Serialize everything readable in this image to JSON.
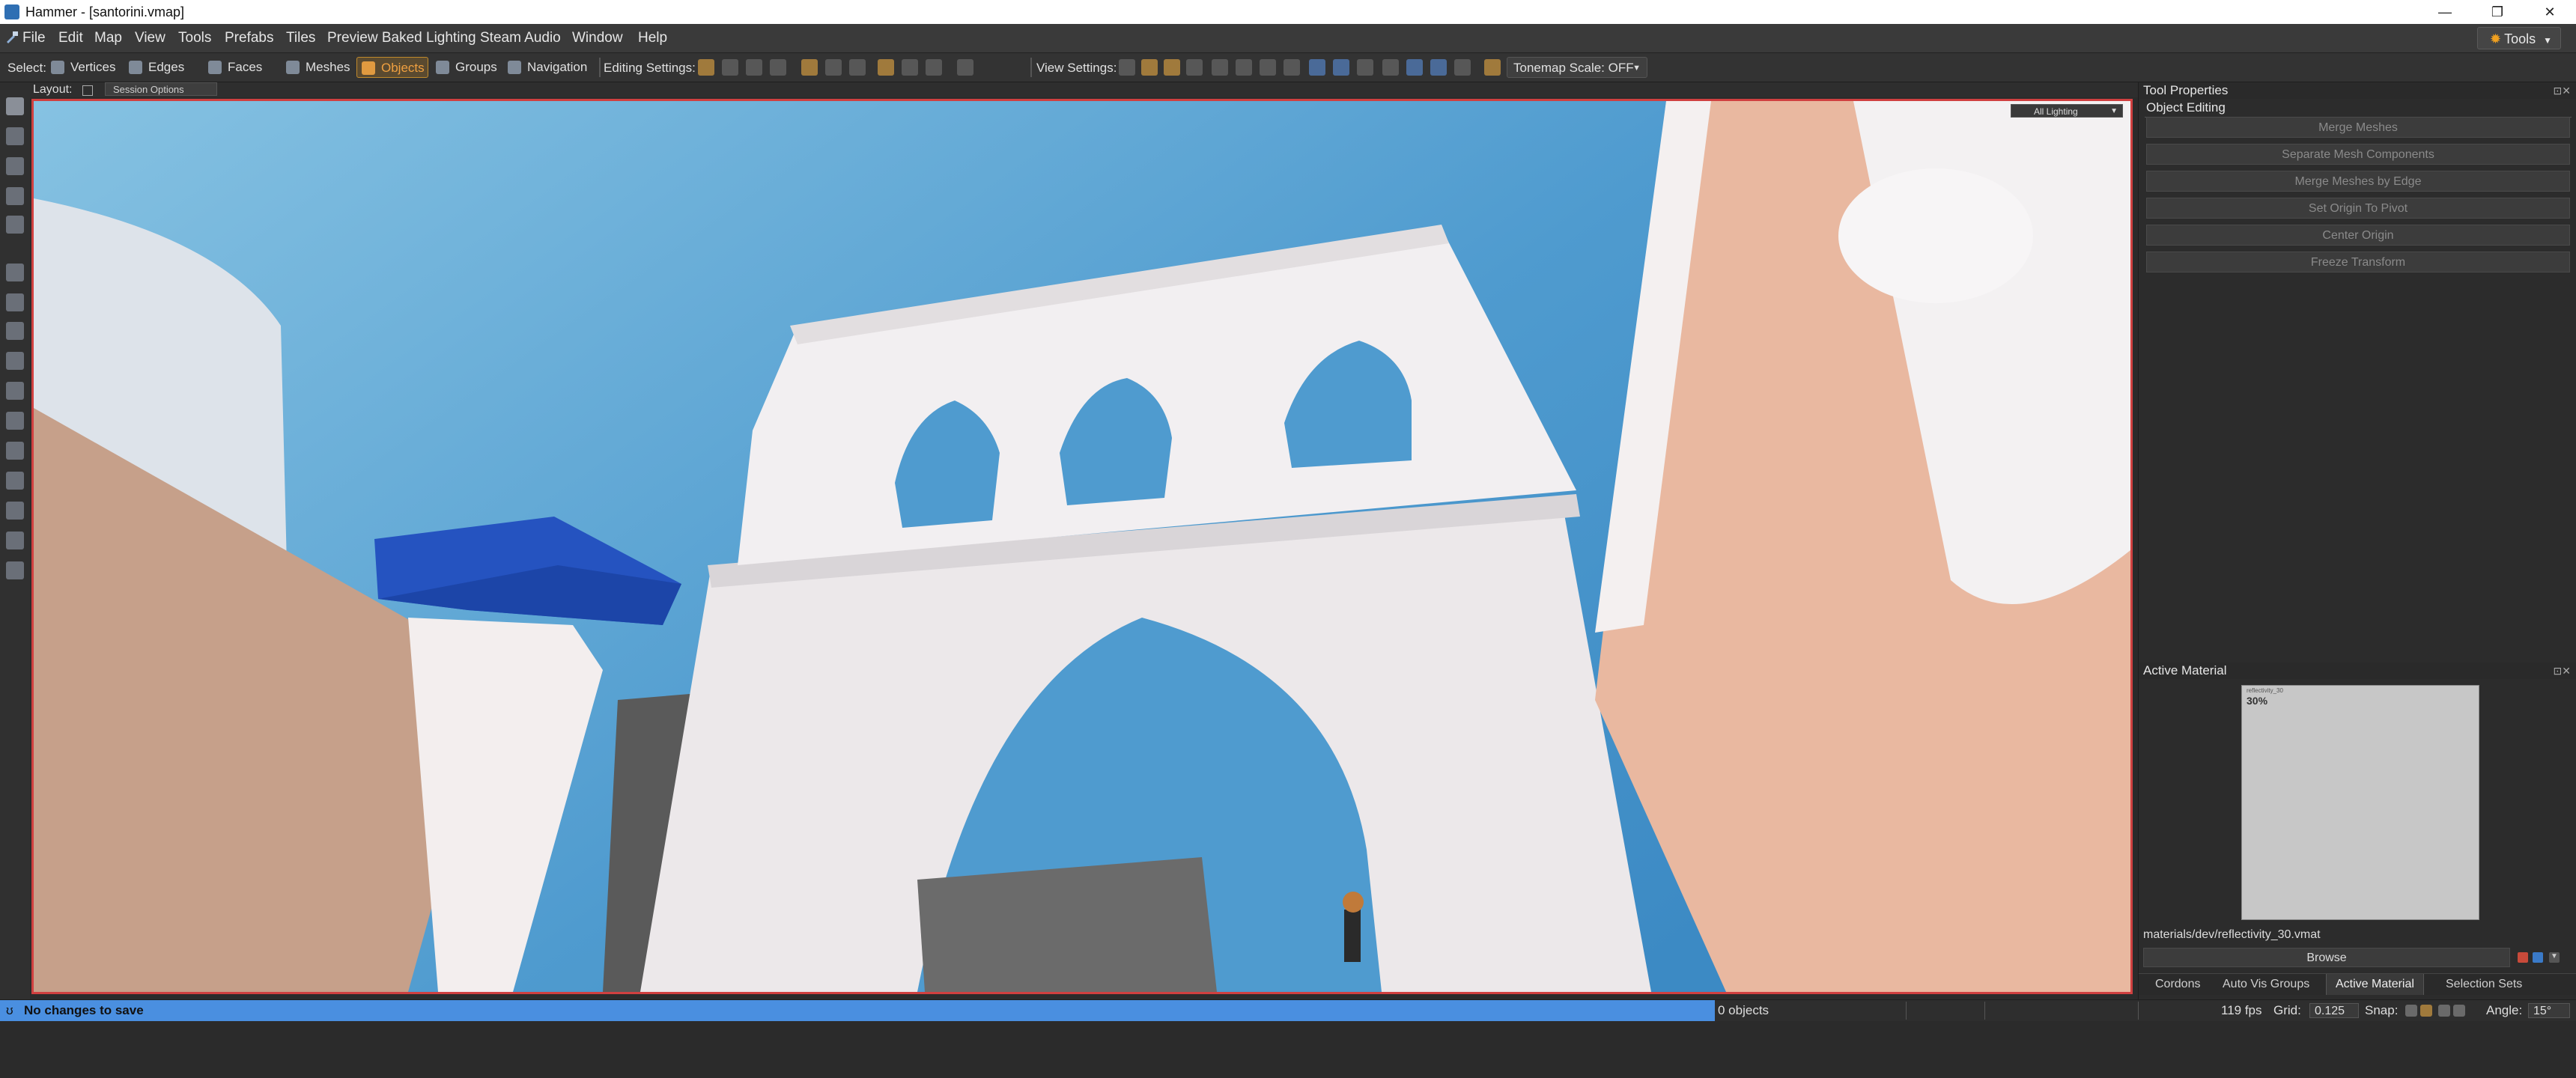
{
  "window": {
    "title": "Hammer - [santorini.vmap]",
    "minimize": "—",
    "restore": "❐",
    "close": "✕"
  },
  "menu": {
    "items": [
      "File",
      "Edit",
      "Map",
      "View",
      "Tools",
      "Prefabs",
      "Tiles",
      "Preview Baked Lighting",
      "Steam Audio",
      "Window",
      "Help"
    ],
    "tools_dropdown": "Tools"
  },
  "toolbar": {
    "select_label": "Select:",
    "select_modes": [
      {
        "label": "Vertices",
        "active": false
      },
      {
        "label": "Edges",
        "active": false
      },
      {
        "label": "Faces",
        "active": false
      },
      {
        "label": "Meshes",
        "active": false
      },
      {
        "label": "Objects",
        "active": true
      },
      {
        "label": "Groups",
        "active": false
      },
      {
        "label": "Navigation",
        "active": false
      }
    ],
    "editing_settings_label": "Editing Settings:",
    "view_settings_label": "View Settings:",
    "tonemap_label": "Tonemap Scale: OFF"
  },
  "layout": {
    "label": "Layout:",
    "dropdown": "Session Options"
  },
  "viewport": {
    "lighting_mode": "All Lighting"
  },
  "tool_properties": {
    "header": "Tool Properties",
    "group_title": "Object Editing",
    "buttons": [
      "Merge Meshes",
      "Separate Mesh Components",
      "Merge Meshes by Edge",
      "Set Origin To Pivot",
      "Center Origin",
      "Freeze Transform"
    ]
  },
  "active_material": {
    "header": "Active Material",
    "preview_label": "reflectivity_30",
    "preview_percent": "30%",
    "path": "materials/dev/reflectivity_30.vmat",
    "browse_label": "Browse"
  },
  "bottom_tabs": [
    {
      "label": "Cordons",
      "active": false
    },
    {
      "label": "Auto Vis Groups",
      "active": false
    },
    {
      "label": "Active Material",
      "active": true
    },
    {
      "label": "Selection Sets",
      "active": false
    }
  ],
  "status": {
    "message": "No changes to save",
    "object_count": "0 objects",
    "fps": "119 fps",
    "grid_label": "Grid:",
    "grid_value": "0.125",
    "snap_label": "Snap:",
    "angle_label": "Angle:",
    "angle_value": "15°"
  }
}
